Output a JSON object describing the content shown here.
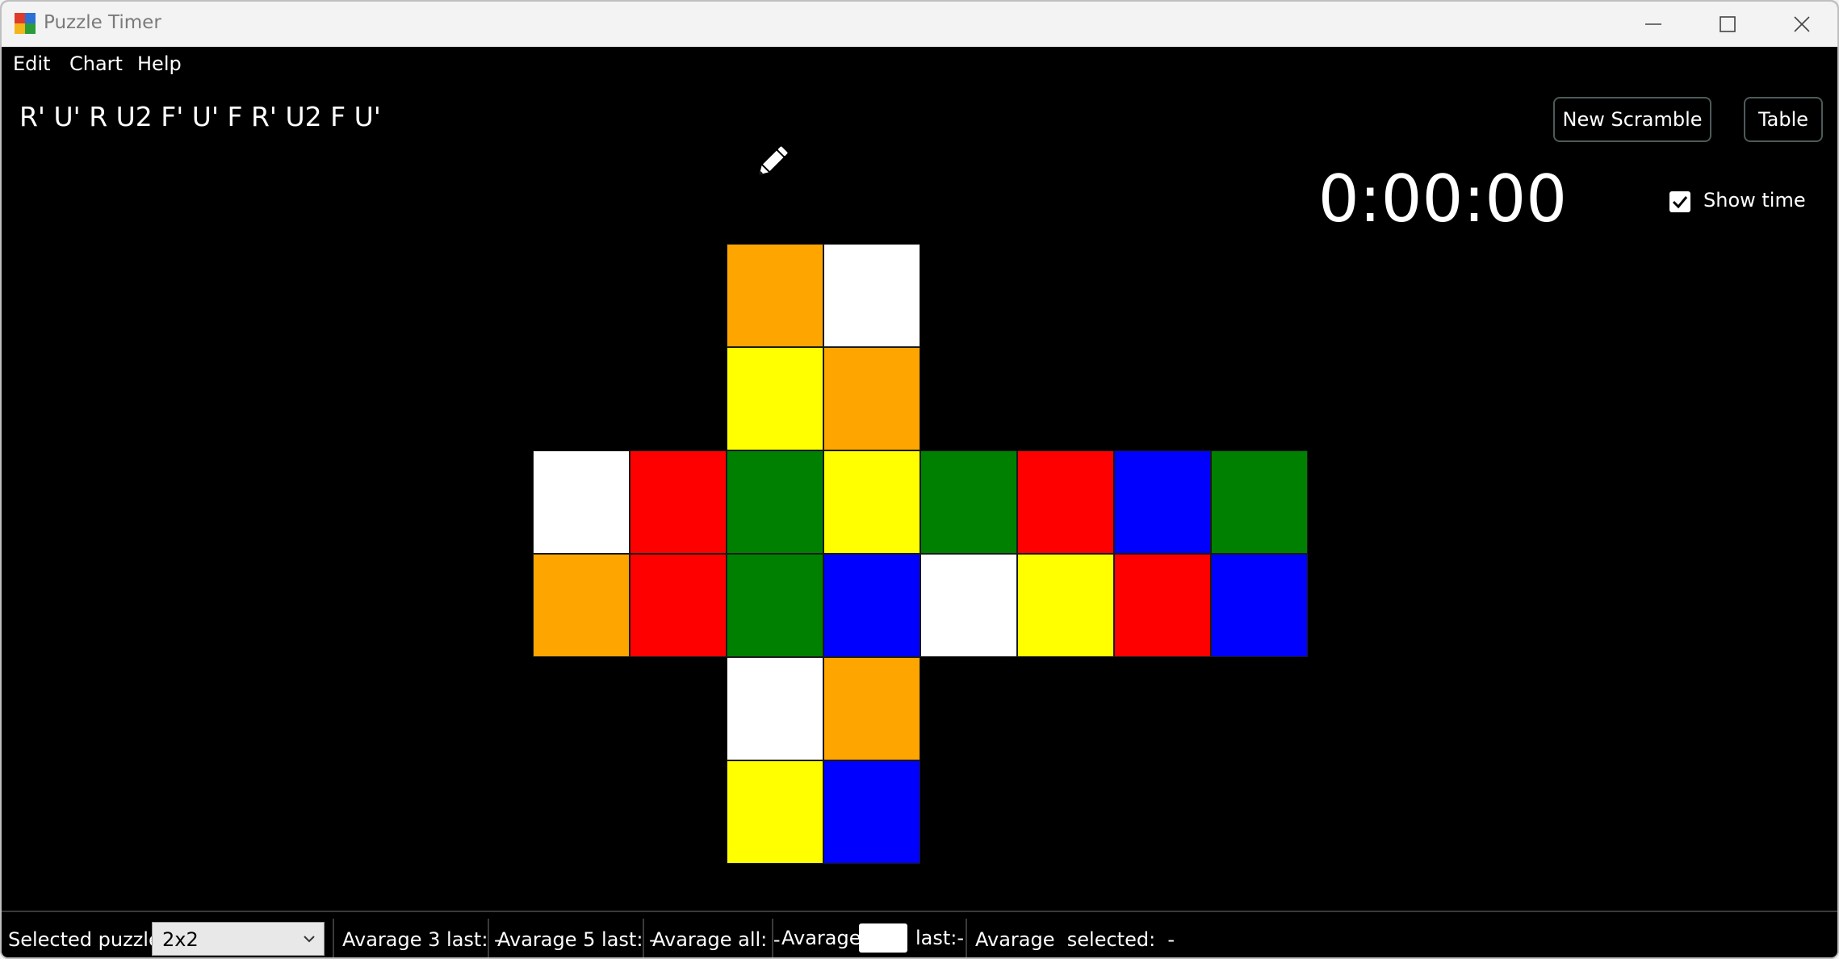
{
  "window": {
    "title": "Puzzle Timer"
  },
  "menu": [
    "Edit",
    "Chart",
    "Help"
  ],
  "scramble": "R' U' R U2 F' U' F R' U2 F U'",
  "buttons": {
    "new_scramble": "New Scramble",
    "table": "Table"
  },
  "timer": {
    "display": "0:00:00",
    "show_time_label": "Show time",
    "show_time_checked": true
  },
  "cube": {
    "colors": {
      "O": "#ffa500",
      "W": "#ffffff",
      "Y": "#ffff00",
      "R": "#ff0000",
      "G": "#008000",
      "B": "#0000ff"
    },
    "rows": [
      "..OW....",
      "..YO....",
      "WRGYGRBG",
      "ORGBWYRB",
      "..WO....",
      "..YB...."
    ]
  },
  "status": {
    "selected_puzzle_label": "Selected puzzle:",
    "selected_puzzle_value": "2x2",
    "avg3": "Avarage 3 last: -",
    "avg5": "Avarage 5 last: -",
    "avg_all": "Avarage all: -",
    "avg_custom_prefix": "Avarage",
    "avg_custom_suffix": "last:-",
    "avg_selected": "Avarage  selected:  -"
  }
}
